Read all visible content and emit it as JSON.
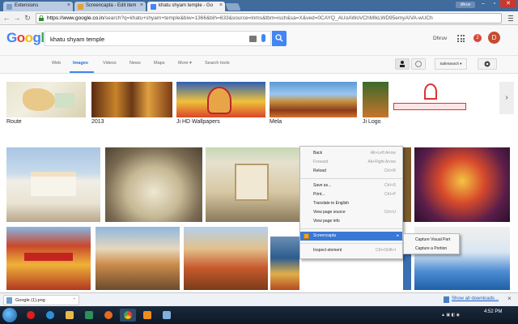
{
  "browser": {
    "tabs": [
      {
        "label": "Extensions",
        "active": false
      },
      {
        "label": "Screencapta - Edit item",
        "active": false
      },
      {
        "label": "khatu shyam temple - Go",
        "active": true
      }
    ],
    "profile_chip": "dhruv",
    "url_host": "https://www.google.co.in",
    "url_path": "/search?q=khatu+shyam+temple&biw=1366&bih=633&source=lnms&tbm=isch&sa=X&ved=0CAYQ_AUoAWoVChMIkLWD95emyAIVA-wUCh"
  },
  "google": {
    "logo": "Google",
    "query": "khatu shyam temple",
    "user_name": "Dhruv",
    "notifications": "2",
    "avatar_letter": "D",
    "nav_tabs": [
      "Web",
      "Images",
      "Videos",
      "News",
      "Maps",
      "More ▾",
      "Search tools"
    ],
    "safesearch": "SafeSearch ▾"
  },
  "related": [
    {
      "label": "Route"
    },
    {
      "label": "2013"
    },
    {
      "label": "Ji HD Wallpapers"
    },
    {
      "label": "Mela"
    },
    {
      "label": "Ji Logo"
    }
  ],
  "context_menu": {
    "items": [
      {
        "label": "Back",
        "shortcut": "Alt+Left Arrow",
        "disabled": false
      },
      {
        "label": "Forward",
        "shortcut": "Alt+Right Arrow",
        "disabled": true
      },
      {
        "label": "Reload",
        "shortcut": "Ctrl+R",
        "disabled": false
      },
      {
        "label": "Save as...",
        "shortcut": "Ctrl+S",
        "disabled": false
      },
      {
        "label": "Print...",
        "shortcut": "Ctrl+P",
        "disabled": false
      },
      {
        "label": "Translate to English",
        "shortcut": "",
        "disabled": false
      },
      {
        "label": "View page source",
        "shortcut": "Ctrl+U",
        "disabled": false
      },
      {
        "label": "View page info",
        "shortcut": "",
        "disabled": false
      },
      {
        "label": "Screencapta",
        "shortcut": "",
        "disabled": false
      },
      {
        "label": "Inspect element",
        "shortcut": "Ctrl+Shift+I",
        "disabled": false
      }
    ],
    "submenu": [
      "Capture Visual Part",
      "Capture a Portion"
    ]
  },
  "downloads": {
    "file": "Google (1).png",
    "show_all": "Show all downloads..."
  },
  "taskbar": {
    "time": "4:52 PM"
  }
}
